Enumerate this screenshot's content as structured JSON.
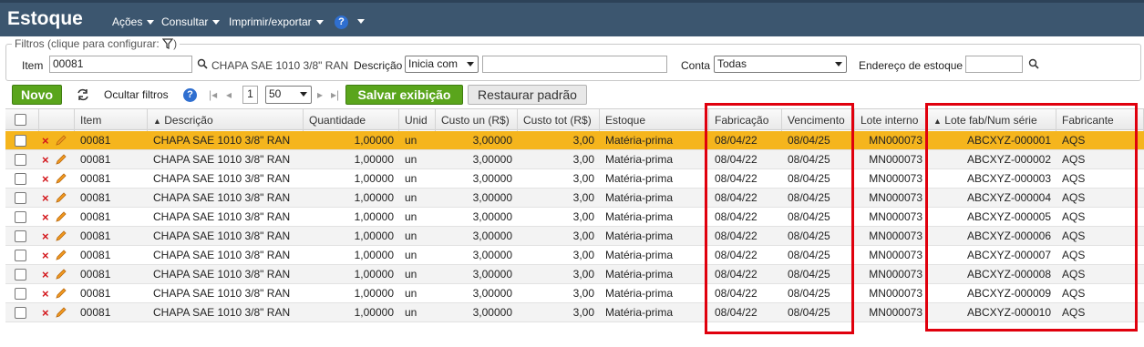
{
  "app": {
    "title": "Estoque",
    "menus": [
      "Ações",
      "Consultar",
      "Imprimir/exportar"
    ],
    "help_label": "?"
  },
  "filters": {
    "legend": "Filtros (clique para configurar:",
    "item_label": "Item",
    "item_value": "00081",
    "item_desc": "CHAPA SAE 1010 3/8\" RAN",
    "descricao_label": "Descrição",
    "descricao_mode": "Inicia com",
    "descricao_value": "",
    "conta_label": "Conta",
    "conta_value": "Todas",
    "endereco_label": "Endereço de estoque",
    "endereco_value": ""
  },
  "toolbar": {
    "novo": "Novo",
    "ocultar": "Ocultar filtros",
    "help": "?",
    "page": "1",
    "per_page": "50",
    "salvar": "Salvar exibição",
    "restaurar": "Restaurar padrão"
  },
  "table": {
    "columns": [
      "Item",
      "Descrição",
      "Quantidade",
      "Unid",
      "Custo un (R$)",
      "Custo tot (R$)",
      "Estoque",
      "Fabricação",
      "Vencimento",
      "Lote interno",
      "Lote fab/Num série",
      "Fabricante"
    ],
    "rows": [
      [
        "00081",
        "CHAPA SAE 1010 3/8\" RAN",
        "1,00000",
        "un",
        "3,00000",
        "3,00",
        "Matéria-prima",
        "08/04/22",
        "08/04/25",
        "MN000073",
        "ABCXYZ-000001",
        "AQS"
      ],
      [
        "00081",
        "CHAPA SAE 1010 3/8\" RAN",
        "1,00000",
        "un",
        "3,00000",
        "3,00",
        "Matéria-prima",
        "08/04/22",
        "08/04/25",
        "MN000073",
        "ABCXYZ-000002",
        "AQS"
      ],
      [
        "00081",
        "CHAPA SAE 1010 3/8\" RAN",
        "1,00000",
        "un",
        "3,00000",
        "3,00",
        "Matéria-prima",
        "08/04/22",
        "08/04/25",
        "MN000073",
        "ABCXYZ-000003",
        "AQS"
      ],
      [
        "00081",
        "CHAPA SAE 1010 3/8\" RAN",
        "1,00000",
        "un",
        "3,00000",
        "3,00",
        "Matéria-prima",
        "08/04/22",
        "08/04/25",
        "MN000073",
        "ABCXYZ-000004",
        "AQS"
      ],
      [
        "00081",
        "CHAPA SAE 1010 3/8\" RAN",
        "1,00000",
        "un",
        "3,00000",
        "3,00",
        "Matéria-prima",
        "08/04/22",
        "08/04/25",
        "MN000073",
        "ABCXYZ-000005",
        "AQS"
      ],
      [
        "00081",
        "CHAPA SAE 1010 3/8\" RAN",
        "1,00000",
        "un",
        "3,00000",
        "3,00",
        "Matéria-prima",
        "08/04/22",
        "08/04/25",
        "MN000073",
        "ABCXYZ-000006",
        "AQS"
      ],
      [
        "00081",
        "CHAPA SAE 1010 3/8\" RAN",
        "1,00000",
        "un",
        "3,00000",
        "3,00",
        "Matéria-prima",
        "08/04/22",
        "08/04/25",
        "MN000073",
        "ABCXYZ-000007",
        "AQS"
      ],
      [
        "00081",
        "CHAPA SAE 1010 3/8\" RAN",
        "1,00000",
        "un",
        "3,00000",
        "3,00",
        "Matéria-prima",
        "08/04/22",
        "08/04/25",
        "MN000073",
        "ABCXYZ-000008",
        "AQS"
      ],
      [
        "00081",
        "CHAPA SAE 1010 3/8\" RAN",
        "1,00000",
        "un",
        "3,00000",
        "3,00",
        "Matéria-prima",
        "08/04/22",
        "08/04/25",
        "MN000073",
        "ABCXYZ-000009",
        "AQS"
      ],
      [
        "00081",
        "CHAPA SAE 1010 3/8\" RAN",
        "1,00000",
        "un",
        "3,00000",
        "3,00",
        "Matéria-prima",
        "08/04/22",
        "08/04/25",
        "MN000073",
        "ABCXYZ-000010",
        "AQS"
      ]
    ],
    "selected_row": 0
  },
  "colors": {
    "header_bar": "#3c566f",
    "selected_row": "#f5b51d",
    "highlight_box": "#e0000d",
    "green_button": "#5aa51c"
  }
}
